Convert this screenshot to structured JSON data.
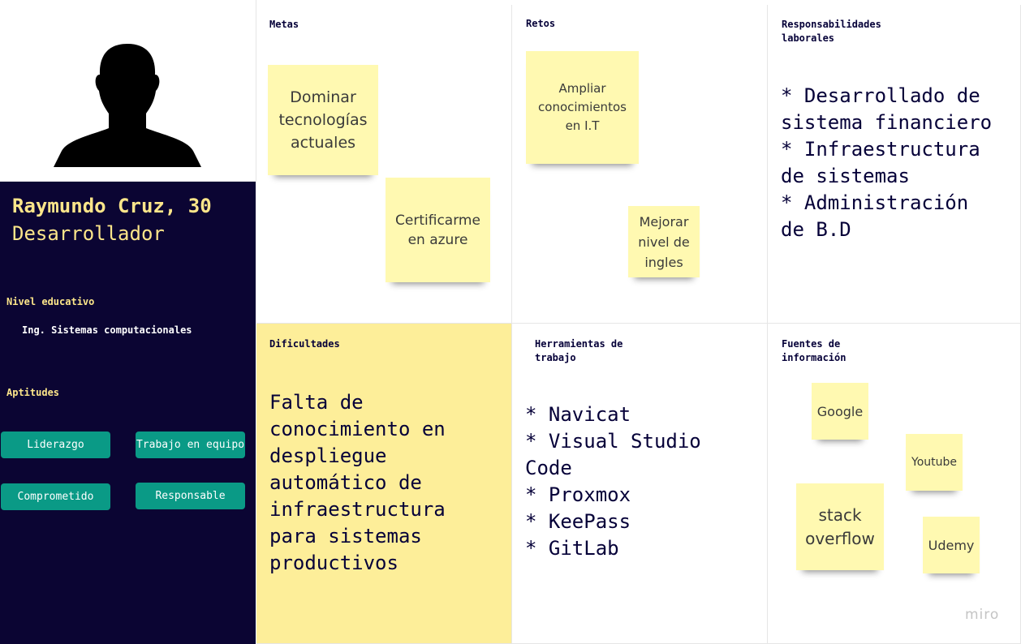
{
  "profile": {
    "name_line": "Raymundo Cruz, 30",
    "role": "Desarrollador",
    "education_label": "Nivel educativo",
    "education_value": "Ing. Sistemas computacionales",
    "skills_label": "Aptitudes",
    "skills": [
      "Liderazgo",
      "Trabajo en equipo",
      "Comprometido",
      "Responsable"
    ]
  },
  "metas": {
    "title": "Metas",
    "notes": [
      "Dominar tecnologías actuales",
      "Certificarme en azure"
    ]
  },
  "retos": {
    "title": "Retos",
    "notes": [
      "Ampliar conocimientos en I.T",
      "Mejorar nivel de ingles"
    ]
  },
  "responsabilidades": {
    "title": "Responsabilidades\nlaborales",
    "text": "* Desarrollado de\nsistema financiero\n* Infraestructura\nde sistemas\n* Administración\nde B.D"
  },
  "dificultades": {
    "title": "Dificultades",
    "text": "Falta de\nconocimiento en\ndespliegue\nautomático de\ninfraestructura\npara sistemas\nproductivos"
  },
  "herramientas": {
    "title": "Herramientas de\ntrabajo",
    "text": "* Navicat\n* Visual Studio\nCode\n* Proxmox\n* KeePass\n* GitLab"
  },
  "fuentes": {
    "title": "Fuentes de\ninformación",
    "notes": [
      "Google",
      "Youtube",
      "stack overflow",
      "Udemy"
    ]
  },
  "branding": {
    "watermark": "miro"
  },
  "colors": {
    "navy": "#0b0533",
    "sticky": "#fff9b1",
    "dificultades_bg": "#fdee99",
    "chip": "#0a9a86",
    "accent_text": "#fde68a"
  }
}
